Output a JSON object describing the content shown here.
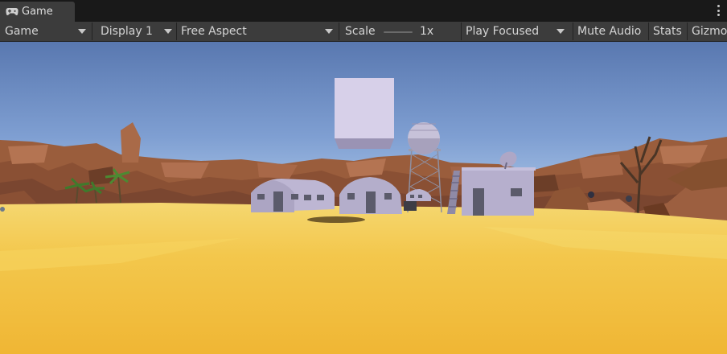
{
  "tab": {
    "label": "Game",
    "icon": "gamepad-icon"
  },
  "toolbar": {
    "mode": {
      "label": "Game"
    },
    "display": {
      "label": "Display 1"
    },
    "aspect": {
      "label": "Free Aspect"
    },
    "scale": {
      "label": "Scale",
      "value": "1x"
    },
    "play_focus": {
      "label": "Play Focused"
    },
    "mute_audio": {
      "label": "Mute Audio"
    },
    "stats": {
      "label": "Stats"
    },
    "gizmos": {
      "label": "Gizmos"
    }
  },
  "viewport": {
    "sky_top": "#5d7bb2",
    "sky_horizon": "#a5c2e8",
    "sand": "#f2c64c",
    "rock": "#9a6040",
    "building": "#aea7c6"
  }
}
